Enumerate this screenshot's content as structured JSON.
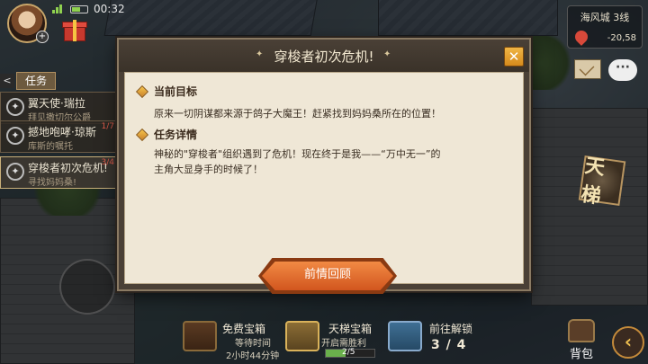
{
  "status_bar": {
    "time": "00:32"
  },
  "location": {
    "name": "海风城 3线",
    "coords": "-20,58"
  },
  "quest_panel": {
    "tab_label": "任务",
    "back_icon": "chevron-left",
    "items": [
      {
        "title": "翼天使·瑞拉",
        "subtitle": "拜见撒切尔公爵",
        "progress": ""
      },
      {
        "title": "撼地咆哮·琼斯",
        "subtitle": "库斯的嘱托",
        "progress": "1/7"
      },
      {
        "title": "穿梭者初次危机!",
        "subtitle": "寻找妈妈桑!",
        "progress": "3/4"
      }
    ]
  },
  "right_icons": {
    "ladder_label": "天梯",
    "chat_icon": "speech-bubble"
  },
  "dialog": {
    "title": "穿梭者初次危机!",
    "close_label": "✕",
    "goal_heading": "当前目标",
    "goal_text": "原来一切阴谋都来源于鸽子大魔王！赶紧找到妈妈桑所在的位置！",
    "details_heading": "任务详情",
    "details_text_1": "神秘的\"穿梭者\"组织遇到了危机！现在终于是我——“万中无一”的",
    "details_text_2": "主角大显身手的时候了！",
    "review_button": "前情回顾"
  },
  "bottom_bar": {
    "free_chest": {
      "title": "免费宝箱",
      "line2": "等待时间",
      "line3": "2小时44分钟"
    },
    "ladder_chest": {
      "title": "天梯宝箱",
      "line2": "开启需胜利",
      "progress_text": "2/5",
      "progress": 0.4
    },
    "unlock": {
      "title": "前往解锁",
      "count": "3 / 4"
    },
    "bag_label": "背包",
    "arrow_label": "‹"
  },
  "colors": {
    "accent_orange": "#e2702f",
    "panel_bg": "#efe7d6",
    "frame": "#4a4036"
  }
}
